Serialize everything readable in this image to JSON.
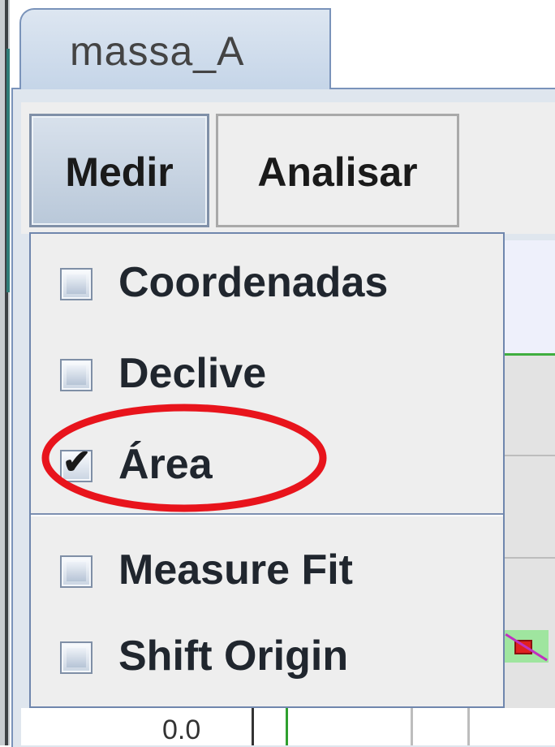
{
  "tab": {
    "label": "massa_A"
  },
  "toolbar": {
    "measure_label": "Medir",
    "analyze_label": "Analisar"
  },
  "menu": {
    "items": [
      {
        "label": "Coordenadas",
        "checked": false
      },
      {
        "label": "Declive",
        "checked": false
      },
      {
        "label": "Área",
        "checked": true
      },
      {
        "label": "Measure Fit",
        "checked": false
      },
      {
        "label": "Shift Origin",
        "checked": false
      }
    ]
  },
  "background": {
    "tick_label": "0.0"
  },
  "colors": {
    "annotation": "#e8141c",
    "menu_border": "#6f86ad",
    "tab_border": "#7a93ba"
  },
  "icons": {
    "checkbox": "checkbox-icon",
    "checkmark": "checkmark-icon"
  }
}
